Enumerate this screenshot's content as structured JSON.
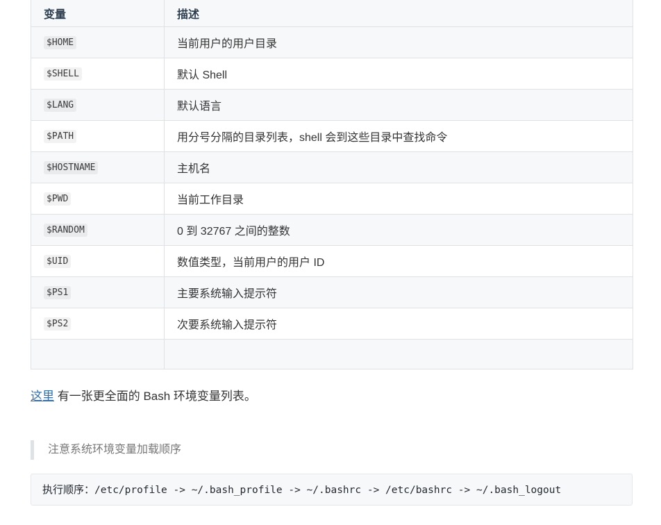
{
  "table": {
    "headers": [
      "变量",
      "描述"
    ],
    "rows": [
      {
        "var": "$HOME",
        "desc": "当前用户的用户目录"
      },
      {
        "var": "$SHELL",
        "desc": "默认 Shell"
      },
      {
        "var": "$LANG",
        "desc": "默认语言"
      },
      {
        "var": "$PATH",
        "desc": "用分号分隔的目录列表，shell 会到这些目录中查找命令"
      },
      {
        "var": "$HOSTNAME",
        "desc": "主机名"
      },
      {
        "var": "$PWD",
        "desc": "当前工作目录"
      },
      {
        "var": "$RANDOM",
        "desc": "0 到 32767 之间的整数"
      },
      {
        "var": "$UID",
        "desc": "数值类型，当前用户的用户 ID"
      },
      {
        "var": "$PS1",
        "desc": "主要系统输入提示符"
      },
      {
        "var": "$PS2",
        "desc": "次要系统输入提示符"
      }
    ]
  },
  "more": {
    "link_text": "这里",
    "text": " 有一张更全面的 Bash 环境变量列表。"
  },
  "note": "注意系统环境变量加载顺序",
  "code": {
    "label": "执行顺序：",
    "command": "/etc/profile -> ~/.bash_profile -> ~/.bashrc -> /etc/bashrc -> ~/.bash_logout"
  }
}
